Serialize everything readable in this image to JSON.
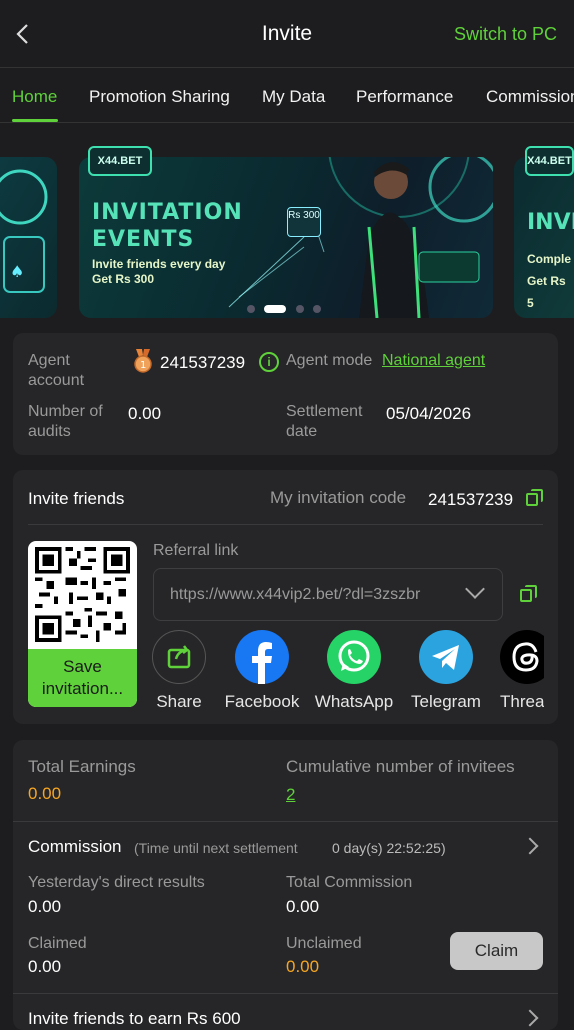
{
  "header": {
    "title": "Invite",
    "switch_label": "Switch to PC"
  },
  "tabs": [
    "Home",
    "Promotion Sharing",
    "My Data",
    "Performance",
    "Commission"
  ],
  "banner": {
    "brand": "X44.BET",
    "heading_line1": "INVITATION",
    "heading_line2": "EVENTS",
    "sub_line1": "Invite friends every day",
    "sub_line2": "Get Rs 300",
    "badge": "Rs 300",
    "next_heading": "INVI",
    "next_sub1": "Comple",
    "next_sub2": "Get Rs 5"
  },
  "agent": {
    "account_label": "Agent account",
    "account_value": "241537239",
    "mode_label": "Agent mode",
    "mode_value": "National agent",
    "audits_label": "Number of audits",
    "audits_value": "0.00",
    "settlement_label": "Settlement date",
    "settlement_value": "05/04/2026"
  },
  "invite": {
    "title": "Invite friends",
    "code_label": "My invitation code",
    "code_value": "241537239",
    "save_label": "Save invitation...",
    "referral_label": "Referral link",
    "referral_value": "https://www.x44vip2.bet/?dl=3zszbr",
    "share": [
      "Share",
      "Facebook",
      "WhatsApp",
      "Telegram",
      "Threa"
    ]
  },
  "earnings": {
    "total_label": "Total Earnings",
    "total_value": "0.00",
    "invitees_label": "Cumulative number of invitees",
    "invitees_value": "2",
    "commission_title": "Commission",
    "commission_note": "(Time until next settlement",
    "countdown": "0 day(s) 22:52:25)",
    "yesterday_label": "Yesterday's direct results",
    "yesterday_value": "0.00",
    "total_comm_label": "Total Commission",
    "total_comm_value": "0.00",
    "claimed_label": "Claimed",
    "claimed_value": "0.00",
    "unclaimed_label": "Unclaimed",
    "unclaimed_value": "0.00",
    "claim_button": "Claim",
    "invite_earn_label": "Invite friends to earn Rs 600"
  },
  "colors": {
    "accent": "#5fd13a",
    "orange": "#f5a623",
    "background": "#1d1d1f",
    "card": "#262628"
  }
}
